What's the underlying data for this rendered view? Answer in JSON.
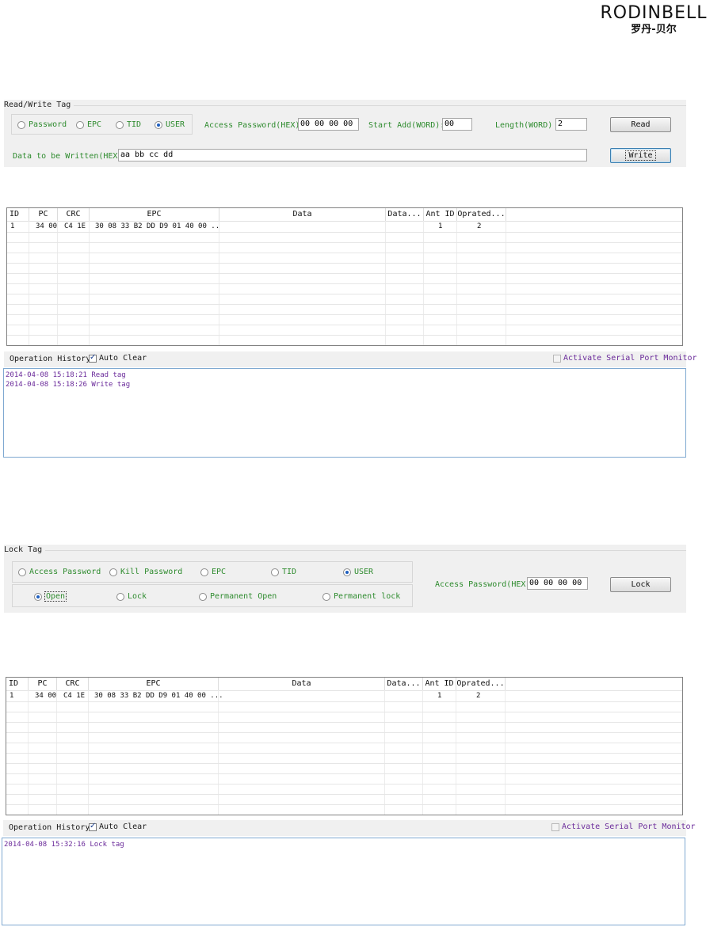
{
  "logo": {
    "word": "RODINBELL",
    "chinese": "罗丹-贝尔"
  },
  "read_write": {
    "group_title": "Read/Write Tag",
    "memory_options": [
      {
        "label": "Password",
        "selected": false
      },
      {
        "label": "EPC",
        "selected": false
      },
      {
        "label": "TID",
        "selected": false
      },
      {
        "label": "USER",
        "selected": true
      }
    ],
    "access_password_label": "Access Password(HEX)",
    "access_password_value": "00 00 00 00",
    "start_add_label": "Start Add(WORD):",
    "start_add_value": "00",
    "length_label": "Length(WORD)",
    "length_value": "2",
    "read_button": "Read",
    "data_label": "Data to be Written(HEX)",
    "data_value": "aa bb cc dd",
    "write_button": "Write"
  },
  "table1": {
    "headers": [
      "ID",
      "PC",
      "CRC",
      "EPC",
      "Data",
      "Data...",
      "Ant ID",
      "Oprated..."
    ],
    "rows": [
      [
        "1",
        "34 00",
        "C4 1E",
        "30 08 33 B2 DD D9 01 40 00 ..",
        "",
        "",
        "1",
        "2"
      ]
    ]
  },
  "history1": {
    "label": "Operation History:",
    "auto_clear": "Auto Clear",
    "monitor": "Activate Serial Port Monitor",
    "lines": [
      "2014-04-08 15:18:21 Read tag",
      "2014-04-08 15:18:26 Write tag"
    ]
  },
  "lock": {
    "group_title": "Lock Tag",
    "memory_options": [
      {
        "label": "Access Password",
        "selected": false
      },
      {
        "label": "Kill Password",
        "selected": false
      },
      {
        "label": "EPC",
        "selected": false
      },
      {
        "label": "TID",
        "selected": false
      },
      {
        "label": "USER",
        "selected": true
      }
    ],
    "lock_options": [
      {
        "label": "Open",
        "selected": true
      },
      {
        "label": "Lock",
        "selected": false
      },
      {
        "label": "Permanent Open",
        "selected": false
      },
      {
        "label": "Permanent lock",
        "selected": false
      }
    ],
    "access_password_label": "Access Password(HEX)",
    "access_password_value": "00 00 00 00",
    "lock_button": "Lock"
  },
  "table2": {
    "headers": [
      "ID",
      "PC",
      "CRC",
      "EPC",
      "Data",
      "Data...",
      "Ant ID",
      "Oprated..."
    ],
    "rows": [
      [
        "1",
        "34 00",
        "C4 1E",
        "30 08 33 B2 DD D9 01 40 00 ...",
        "",
        "",
        "1",
        "2"
      ]
    ]
  },
  "history2": {
    "label": "Operation History:",
    "auto_clear": "Auto Clear",
    "monitor": "Activate Serial Port Monitor",
    "lines": [
      "2014-04-08 15:32:16 Lock tag"
    ]
  }
}
